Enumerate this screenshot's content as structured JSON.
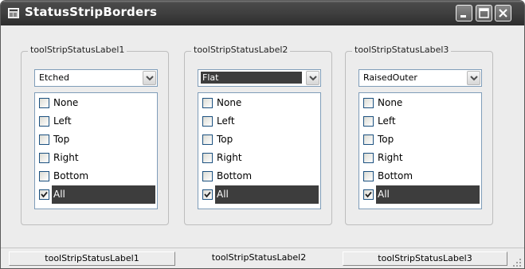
{
  "window": {
    "title": "StatusStripBorders"
  },
  "groups": [
    {
      "legend": "toolStripStatusLabel1",
      "combo_value": "Etched",
      "items": [
        {
          "label": "None",
          "checked": false
        },
        {
          "label": "Left",
          "checked": false
        },
        {
          "label": "Top",
          "checked": false
        },
        {
          "label": "Right",
          "checked": false
        },
        {
          "label": "Bottom",
          "checked": false
        },
        {
          "label": "All",
          "checked": true
        }
      ]
    },
    {
      "legend": "toolStripStatusLabel2",
      "combo_value": "Flat",
      "items": [
        {
          "label": "None",
          "checked": false
        },
        {
          "label": "Left",
          "checked": false
        },
        {
          "label": "Top",
          "checked": false
        },
        {
          "label": "Right",
          "checked": false
        },
        {
          "label": "Bottom",
          "checked": false
        },
        {
          "label": "All",
          "checked": true
        }
      ]
    },
    {
      "legend": "toolStripStatusLabel3",
      "combo_value": "RaisedOuter",
      "items": [
        {
          "label": "None",
          "checked": false
        },
        {
          "label": "Left",
          "checked": false
        },
        {
          "label": "Top",
          "checked": false
        },
        {
          "label": "Right",
          "checked": false
        },
        {
          "label": "Bottom",
          "checked": false
        },
        {
          "label": "All",
          "checked": true
        }
      ]
    }
  ],
  "statusbar": {
    "labels": [
      "toolStripStatusLabel1",
      "toolStripStatusLabel2",
      "toolStripStatusLabel3"
    ]
  }
}
